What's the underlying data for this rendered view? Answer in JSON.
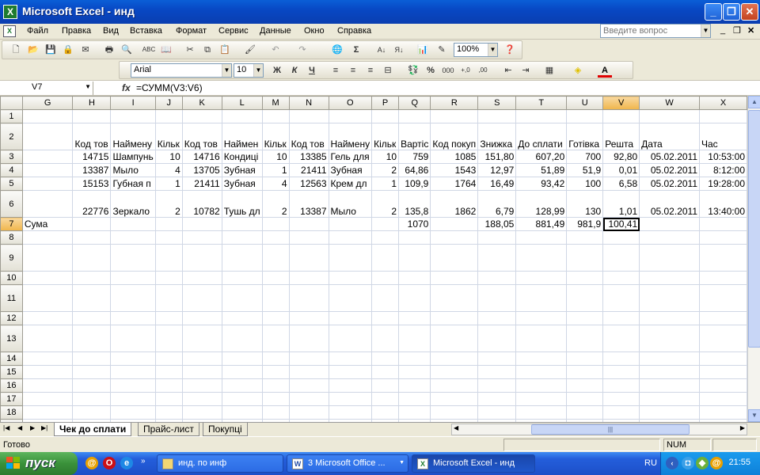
{
  "window": {
    "title": "Microsoft Excel - инд"
  },
  "menu": {
    "items": [
      "Файл",
      "Правка",
      "Вид",
      "Вставка",
      "Формат",
      "Сервис",
      "Данные",
      "Окно",
      "Справка"
    ],
    "help_placeholder": "Введите вопрос"
  },
  "toolbar": {
    "zoom": "100%",
    "font_name": "Arial",
    "font_size": "10",
    "bold": "Ж",
    "italic": "К",
    "underline": "Ч",
    "percent": "%",
    "thousands": "000"
  },
  "formula_bar": {
    "name_box": "V7",
    "fx": "fx",
    "formula": "=СУММ(V3:V6)"
  },
  "grid": {
    "columns": [
      "G",
      "H",
      "I",
      "J",
      "K",
      "L",
      "M",
      "N",
      "O",
      "P",
      "Q",
      "R",
      "S",
      "T",
      "U",
      "V",
      "W",
      "X"
    ],
    "active_column": "V",
    "rows": [
      {
        "num": "1",
        "cells": [
          "",
          "",
          "",
          "",
          "",
          "",
          "",
          "",
          "",
          "",
          "",
          "",
          "",
          "",
          "",
          "",
          "",
          ""
        ]
      },
      {
        "num": "2",
        "cells": [
          "",
          "Код тов",
          "Наймену",
          "Кільк",
          "Код тов",
          "Наймен",
          "Кільк",
          "Код тов",
          "Наймену",
          "Кільк",
          "Вартіс",
          "Код покуп",
          "Знижка",
          "До сплати",
          "Готівка",
          "Решта",
          "Дата",
          "Час"
        ]
      },
      {
        "num": "3",
        "cells": [
          "",
          "14715",
          "Шампунь",
          "10",
          "14716",
          "Кондиці",
          "10",
          "13385",
          "Гель для",
          "10",
          "759",
          "1085",
          "151,80",
          "607,20",
          "700",
          "92,80",
          "05.02.2011",
          "10:53:00"
        ]
      },
      {
        "num": "4",
        "cells": [
          "",
          "13387",
          "Мыло",
          "4",
          "13705",
          "Зубная",
          "1",
          "21411",
          "Зубная",
          "2",
          "64,86",
          "1543",
          "12,97",
          "51,89",
          "51,9",
          "0,01",
          "05.02.2011",
          "8:12:00"
        ]
      },
      {
        "num": "5",
        "cells": [
          "",
          "15153",
          "Губная п",
          "1",
          "21411",
          "Зубная",
          "4",
          "12563",
          "Крем дл",
          "1",
          "109,9",
          "1764",
          "16,49",
          "93,42",
          "100",
          "6,58",
          "05.02.2011",
          "19:28:00"
        ]
      },
      {
        "num": "6",
        "cells": [
          "",
          "22776",
          "Зеркало",
          "2",
          "10782",
          "Тушь дл",
          "2",
          "13387",
          "Мыло",
          "2",
          "135,8",
          "1862",
          "6,79",
          "128,99",
          "130",
          "1,01",
          "05.02.2011",
          "13:40:00"
        ]
      },
      {
        "num": "7",
        "cells": [
          "Сума",
          "",
          "",
          "",
          "",
          "",
          "",
          "",
          "",
          "",
          "1070",
          "",
          "188,05",
          "881,49",
          "981,9",
          "100,41",
          "",
          ""
        ]
      },
      {
        "num": "8",
        "cells": [
          "",
          "",
          "",
          "",
          "",
          "",
          "",
          "",
          "",
          "",
          "",
          "",
          "",
          "",
          "",
          "",
          "",
          ""
        ]
      },
      {
        "num": "9",
        "cells": [
          "",
          "",
          "",
          "",
          "",
          "",
          "",
          "",
          "",
          "",
          "",
          "",
          "",
          "",
          "",
          "",
          "",
          ""
        ]
      },
      {
        "num": "10",
        "cells": [
          "",
          "",
          "",
          "",
          "",
          "",
          "",
          "",
          "",
          "",
          "",
          "",
          "",
          "",
          "",
          "",
          "",
          ""
        ]
      },
      {
        "num": "11",
        "cells": [
          "",
          "",
          "",
          "",
          "",
          "",
          "",
          "",
          "",
          "",
          "",
          "",
          "",
          "",
          "",
          "",
          "",
          ""
        ]
      },
      {
        "num": "12",
        "cells": [
          "",
          "",
          "",
          "",
          "",
          "",
          "",
          "",
          "",
          "",
          "",
          "",
          "",
          "",
          "",
          "",
          "",
          ""
        ]
      },
      {
        "num": "13",
        "cells": [
          "",
          "",
          "",
          "",
          "",
          "",
          "",
          "",
          "",
          "",
          "",
          "",
          "",
          "",
          "",
          "",
          "",
          ""
        ]
      },
      {
        "num": "14",
        "cells": [
          "",
          "",
          "",
          "",
          "",
          "",
          "",
          "",
          "",
          "",
          "",
          "",
          "",
          "",
          "",
          "",
          "",
          ""
        ]
      },
      {
        "num": "15",
        "cells": [
          "",
          "",
          "",
          "",
          "",
          "",
          "",
          "",
          "",
          "",
          "",
          "",
          "",
          "",
          "",
          "",
          "",
          ""
        ]
      },
      {
        "num": "16",
        "cells": [
          "",
          "",
          "",
          "",
          "",
          "",
          "",
          "",
          "",
          "",
          "",
          "",
          "",
          "",
          "",
          "",
          "",
          ""
        ]
      },
      {
        "num": "17",
        "cells": [
          "",
          "",
          "",
          "",
          "",
          "",
          "",
          "",
          "",
          "",
          "",
          "",
          "",
          "",
          "",
          "",
          "",
          ""
        ]
      },
      {
        "num": "18",
        "cells": [
          "",
          "",
          "",
          "",
          "",
          "",
          "",
          "",
          "",
          "",
          "",
          "",
          "",
          "",
          "",
          "",
          "",
          ""
        ]
      },
      {
        "num": "19",
        "cells": [
          "",
          "",
          "",
          "",
          "",
          "",
          "",
          "",
          "",
          "",
          "",
          "",
          "",
          "",
          "",
          "",
          "",
          ""
        ]
      }
    ]
  },
  "sheet_tabs": [
    "Чек до сплати",
    "Прайс-лист",
    "Покупці"
  ],
  "active_tab": 0,
  "status": {
    "ready": "Готово",
    "num": "NUM"
  },
  "taskbar": {
    "start": "пуск",
    "buttons": [
      "инд. по инф",
      "3 Microsoft Office ...",
      "Microsoft Excel - инд"
    ],
    "lang": "RU",
    "clock": "21:55"
  }
}
